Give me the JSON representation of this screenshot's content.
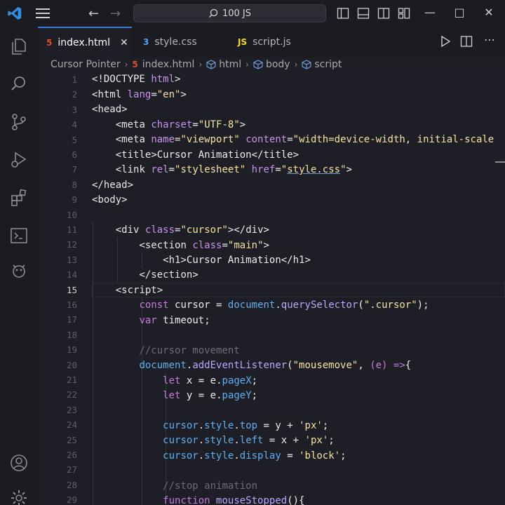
{
  "titlebar": {
    "search_text": "100 JS",
    "back_icon": "arrow-left-icon",
    "forward_icon": "arrow-right-icon"
  },
  "tabs": [
    {
      "label": "index.html",
      "icon": "H5",
      "icon_color": "#e44d26",
      "active": true
    },
    {
      "label": "style.css",
      "icon": "3",
      "icon_color": "#42a5f5",
      "active": false
    },
    {
      "label": "script.js",
      "icon": "JS",
      "icon_color": "#f5de19",
      "active": false
    }
  ],
  "breadcrumb": [
    "Cursor Pointer",
    "index.html",
    "html",
    "body",
    "script"
  ],
  "editor": {
    "active_line": 15,
    "line_numbers": [
      "1",
      "2",
      "3",
      "4",
      "5",
      "6",
      "7",
      "8",
      "9",
      "10",
      "11",
      "12",
      "13",
      "14",
      "15",
      "16",
      "17",
      "18",
      "19",
      "20",
      "21",
      "22",
      "23",
      "24",
      "25",
      "26",
      "27",
      "28",
      "29"
    ]
  },
  "colors": {
    "accent": "#3c7bd6",
    "html_icon": "#e44d26",
    "css_icon": "#42a5f5",
    "js_icon": "#f5de19",
    "editor_bg": "#1e1f26"
  }
}
